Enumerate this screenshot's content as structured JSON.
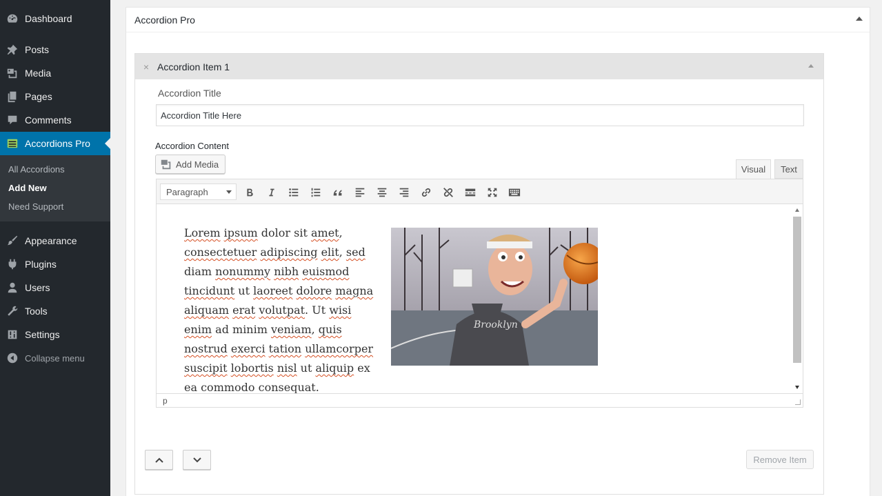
{
  "sidebar": {
    "items": [
      {
        "label": "Dashboard",
        "icon": "dashboard-icon"
      },
      {
        "label": "Posts",
        "icon": "pin-icon"
      },
      {
        "label": "Media",
        "icon": "media-icon"
      },
      {
        "label": "Pages",
        "icon": "pages-icon"
      },
      {
        "label": "Comments",
        "icon": "comment-icon"
      },
      {
        "label": "Accordions Pro",
        "icon": "accordion-icon"
      },
      {
        "label": "Appearance",
        "icon": "brush-icon"
      },
      {
        "label": "Plugins",
        "icon": "plugin-icon"
      },
      {
        "label": "Users",
        "icon": "user-icon"
      },
      {
        "label": "Tools",
        "icon": "wrench-icon"
      },
      {
        "label": "Settings",
        "icon": "settings-icon"
      }
    ],
    "submenu": [
      {
        "label": "All Accordions"
      },
      {
        "label": "Add New"
      },
      {
        "label": "Need Support"
      }
    ],
    "collapse_label": "Collapse menu",
    "active_color": "#0073aa"
  },
  "panel": {
    "title": "Accordion Pro"
  },
  "item": {
    "title": "Accordion Item 1",
    "close_glyph": "×",
    "title_label": "Accordion Title",
    "title_value": "Accordion Title Here",
    "content_label": "Accordion Content",
    "add_media_label": "Add Media",
    "tabs": {
      "visual": "Visual",
      "text": "Text"
    },
    "format_select": "Paragraph",
    "editor_text": [
      "Lorem",
      " ",
      "ipsum",
      " dolor sit ",
      "amet",
      ", ",
      "consectetuer",
      " ",
      "adipiscing",
      " ",
      "elit",
      ", ",
      "sed",
      " diam ",
      "nonummy",
      " ",
      "nibh",
      " ",
      "euismod",
      " ",
      "tincidunt",
      " ut ",
      "laoreet",
      " ",
      "dolore",
      " ",
      "magna",
      " ",
      "aliquam",
      " ",
      "erat",
      " ",
      "volutpat",
      ". Ut ",
      "wisi",
      " ",
      "enim",
      " ad minim ",
      "veniam",
      ", ",
      "quis",
      " ",
      "nostrud",
      " ",
      "exerci",
      " ",
      "tation",
      " ",
      "ullamcorper",
      " ",
      "suscipit",
      " ",
      "lobortis",
      " ",
      "nisl",
      " ut ",
      "aliquip",
      " ex ea ",
      "commodo",
      " ",
      "consequat",
      "."
    ],
    "status_path": "p",
    "remove_label": "Remove Item"
  }
}
